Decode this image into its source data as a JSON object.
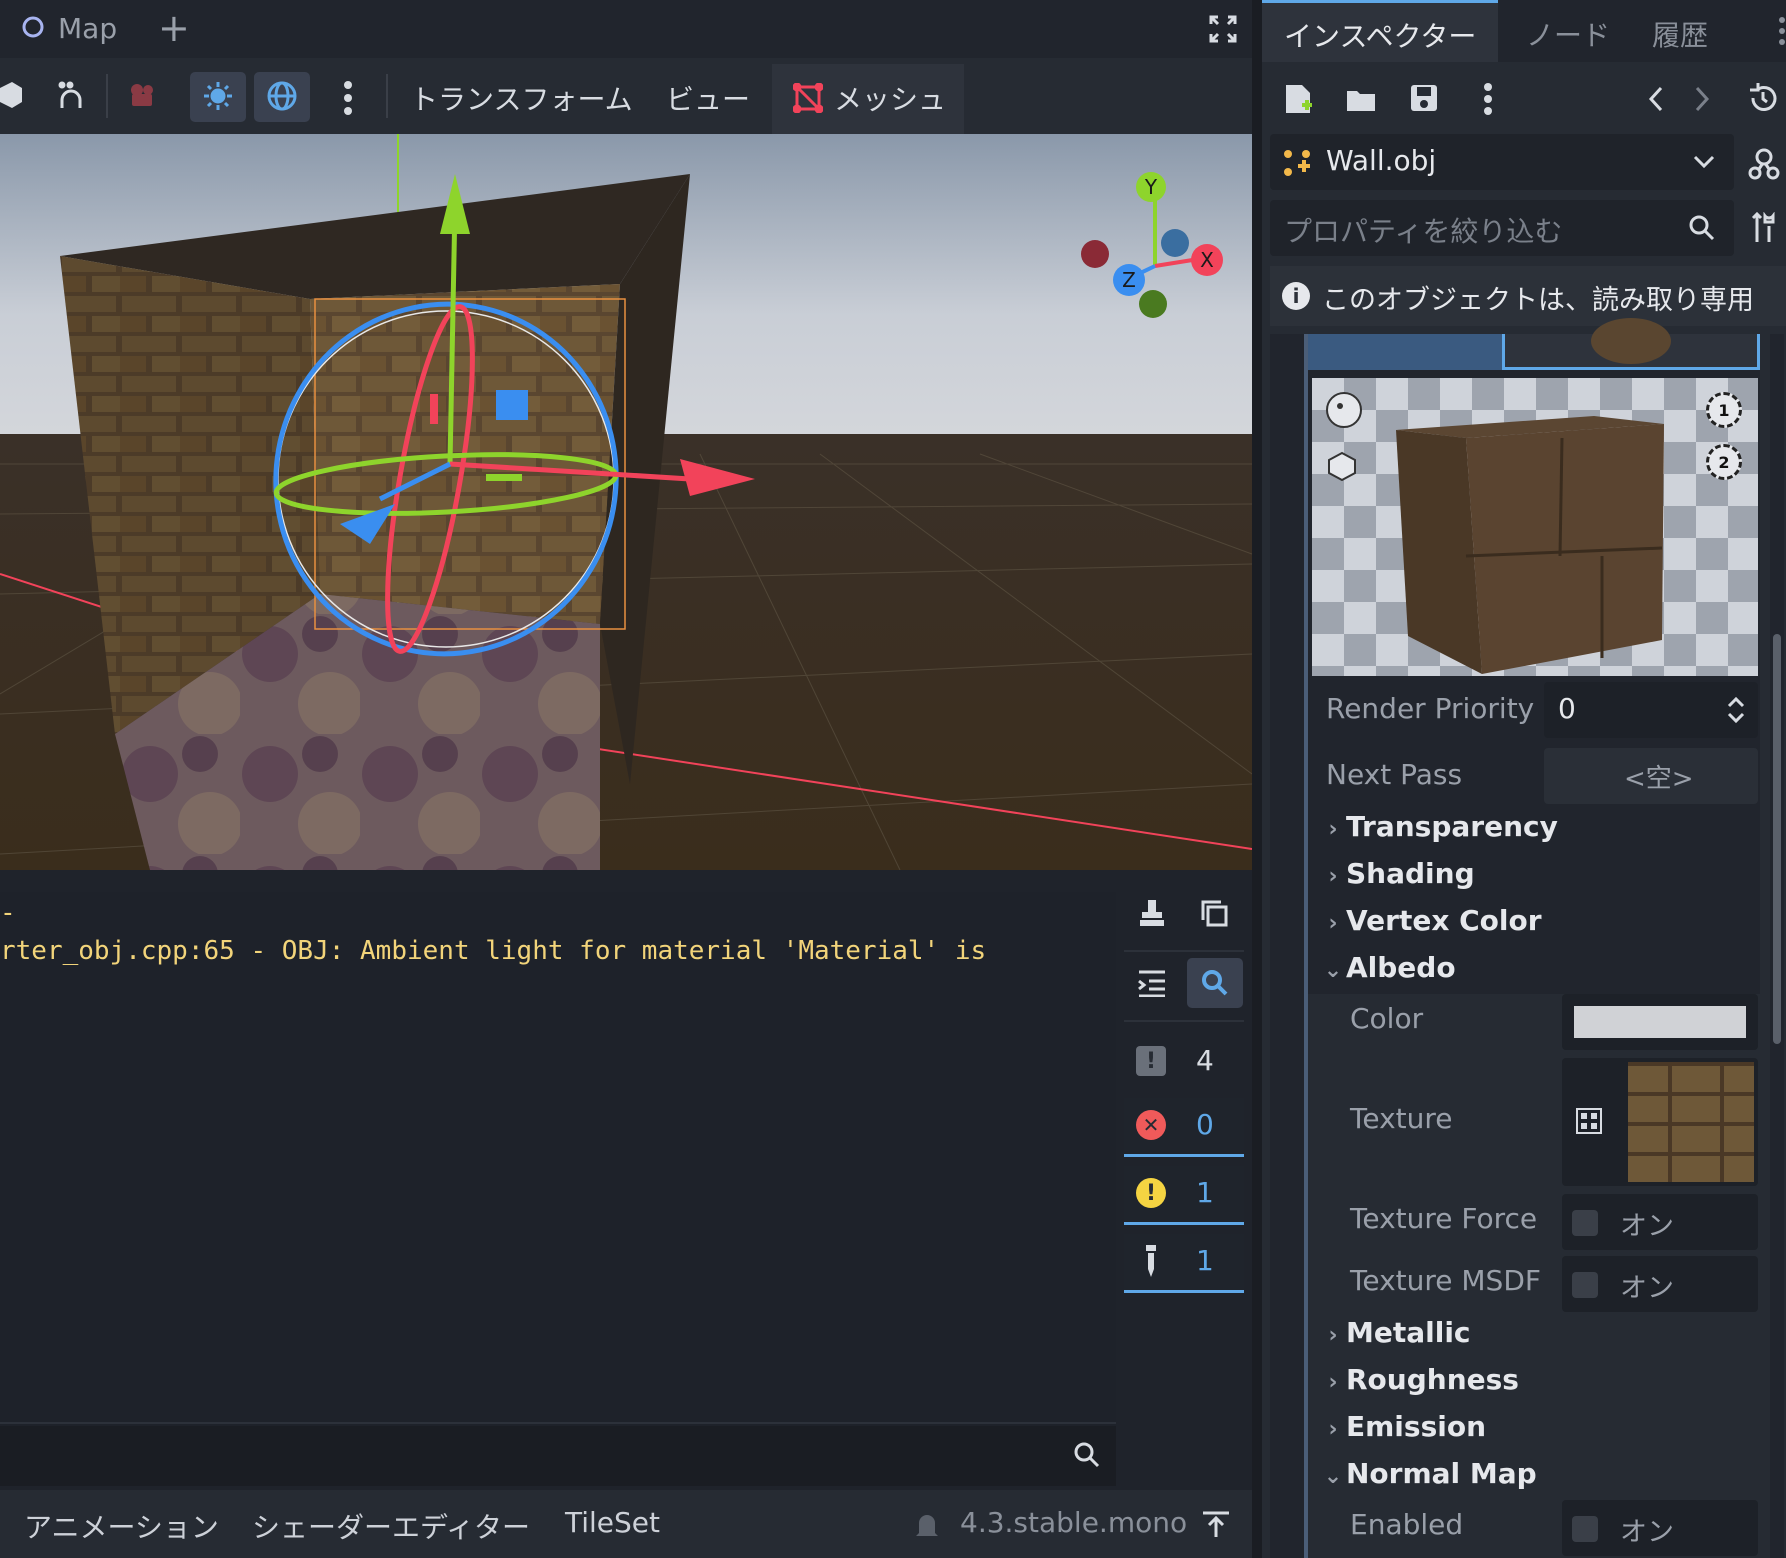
{
  "scene_tab": {
    "title": "Map",
    "add": "+"
  },
  "toolbar": {
    "transform": "トランスフォーム",
    "view": "ビュー",
    "mesh": "メッシュ"
  },
  "gizmo": {
    "x": "X",
    "y": "Y",
    "z": "Z"
  },
  "console": {
    "line1": "-",
    "line2": "rter_obj.cpp:65 - OBJ: Ambient light for material 'Material' is",
    "counts": {
      "messages": "4",
      "errors": "0",
      "warnings": "1",
      "editor": "1"
    }
  },
  "bottom": {
    "tabs": [
      "アニメーション",
      "シェーダーエディター",
      "TileSet"
    ],
    "version": "4.3.stable.mono"
  },
  "inspector": {
    "tabs": [
      "インスペクター",
      "ノード",
      "履歴"
    ],
    "resource": "Wall.obj",
    "filter_placeholder": "プロパティを絞り込む",
    "readonly_note": "このオブジェクトは、読み取り専用",
    "render_priority_label": "Render Priority",
    "render_priority_value": "0",
    "next_pass_label": "Next Pass",
    "next_pass_value": "<空>",
    "sections_top": [
      "Transparency",
      "Shading",
      "Vertex Color"
    ],
    "albedo": "Albedo",
    "color_label": "Color",
    "texture_label": "Texture",
    "texture_force_label": "Texture Force",
    "texture_msdf_label": "Texture MSDF",
    "on_label": "オン",
    "sections_mid": [
      "Metallic",
      "Roughness",
      "Emission"
    ],
    "normal_map": "Normal Map",
    "enabled_label": "Enabled",
    "preview_lights": [
      "1",
      "2"
    ]
  },
  "colors": {
    "accent": "#5fa8e8",
    "x_axis": "#f2435a",
    "y_axis": "#8ed42c",
    "z_axis": "#3a8ef0",
    "warning": "#f5d442",
    "error": "#f05a5a",
    "console_text": "#f2d47a"
  }
}
